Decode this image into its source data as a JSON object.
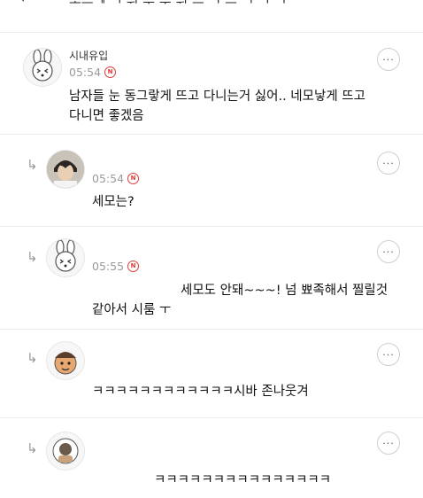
{
  "top_fragment": {
    "text": "ᅩᅳᅦ ᅥ ᅱ ᅮ ᅮ ᅱ ᅳ ᅥ ᅳ ᅵ ᅥ ᅥ"
  },
  "comments": [
    {
      "name": "시내유입",
      "time": "05:54",
      "badge": "N",
      "text": [
        "남자들 눈 동그랗게 뜨고 다니는거 싫어.. 네모낳게 뜨고",
        "다니면 좋겠음"
      ],
      "more": "···",
      "reply": false
    },
    {
      "name": "",
      "time": "05:54",
      "badge": "N",
      "text": [
        "세모는?"
      ],
      "more": "···",
      "reply": true
    },
    {
      "name": "",
      "time": "05:55",
      "badge": "N",
      "text": [
        "세모도 안돼~~~! 넘 뾰족해서 찔릴것",
        "같아서 시룸 ㅜ"
      ],
      "more": "···",
      "reply": true
    },
    {
      "name": "",
      "time": "",
      "badge": "",
      "text": [
        "ㅋㅋㅋㅋㅋㅋㅋㅋㅋㅋㅋㅋ시바 존나웃겨"
      ],
      "more": "···",
      "reply": true
    },
    {
      "name": "",
      "time": "",
      "badge": "",
      "text": [
        "ㅋㅋㅋㅋㅋㅋㅋㅋㅋㅋㅋㅋㅋㅋㅋ"
      ],
      "more": "···",
      "reply": true
    }
  ],
  "icons": {
    "reply": "reply-arrow-icon",
    "more": "more-options-icon",
    "badge": "new-badge-icon"
  }
}
